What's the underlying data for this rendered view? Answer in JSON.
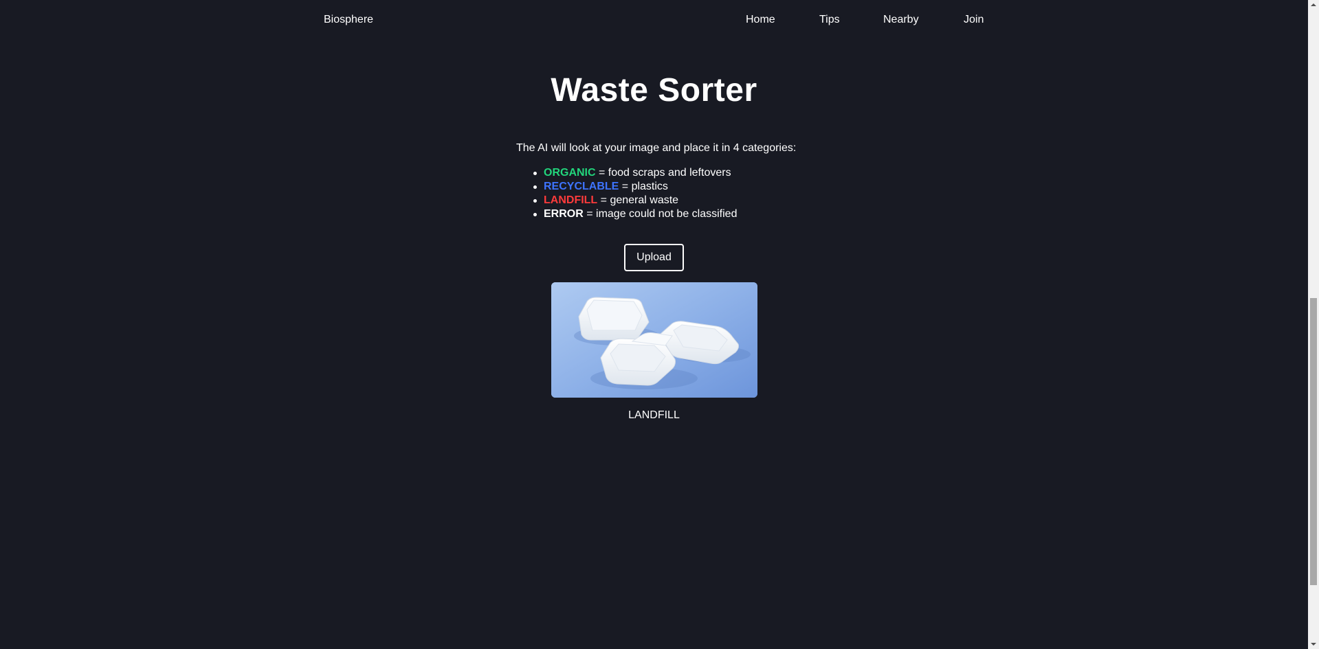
{
  "nav": {
    "brand": "Biosphere",
    "links": {
      "home": "Home",
      "tips": "Tips",
      "nearby": "Nearby",
      "join": "Join"
    }
  },
  "main": {
    "title": "Waste Sorter",
    "intro": "The AI will look at your image and place it in 4 categories:",
    "categories": [
      {
        "name": "ORGANIC",
        "description": " = food scraps and leftovers",
        "color": "#22d67c"
      },
      {
        "name": "RECYCLABLE",
        "description": " = plastics",
        "color": "#3e74ff"
      },
      {
        "name": "LANDFILL",
        "description": " = general waste",
        "color": "#ff3b3b"
      },
      {
        "name": "ERROR",
        "description": " = image could not be classified",
        "color": "#ffffff"
      }
    ],
    "upload_label": "Upload",
    "result": "LANDFILL"
  },
  "colors": {
    "background": "#181a23",
    "text": "#ffffff",
    "image_background": "#88abe6"
  }
}
